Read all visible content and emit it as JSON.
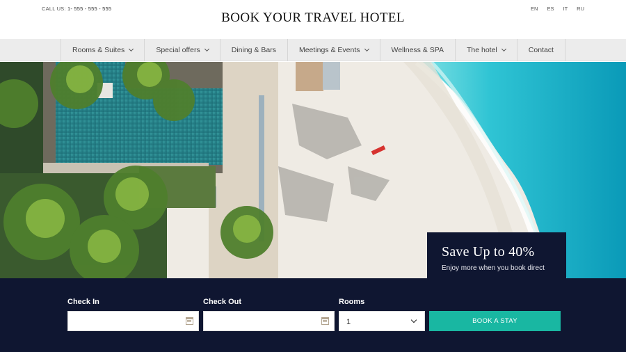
{
  "header": {
    "call_prefix": "CALL US:",
    "phone": "1- 555 - 555 - 555",
    "brand": "BOOK YOUR TRAVEL HOTEL",
    "languages": [
      "EN",
      "ES",
      "IT",
      "RU"
    ]
  },
  "nav": {
    "items": [
      {
        "label": "Rooms & Suites"
      },
      {
        "label": "Special offers"
      },
      {
        "label": "Dining & Bars"
      },
      {
        "label": "Meetings & Events"
      },
      {
        "label": "Wellness & SPA"
      },
      {
        "label": "The hotel"
      },
      {
        "label": "Contact"
      }
    ]
  },
  "promo": {
    "title": "Save Up to 40%",
    "subtitle": "Enjoy more when you book direct"
  },
  "booking": {
    "check_in_label": "Check In",
    "check_out_label": "Check Out",
    "rooms_label": "Rooms",
    "rooms_value": "1",
    "button_label": "BOOK A STAY"
  },
  "colors": {
    "navy": "#0f1631",
    "teal_button": "#19b7a2",
    "nav_bg": "#ececec"
  }
}
